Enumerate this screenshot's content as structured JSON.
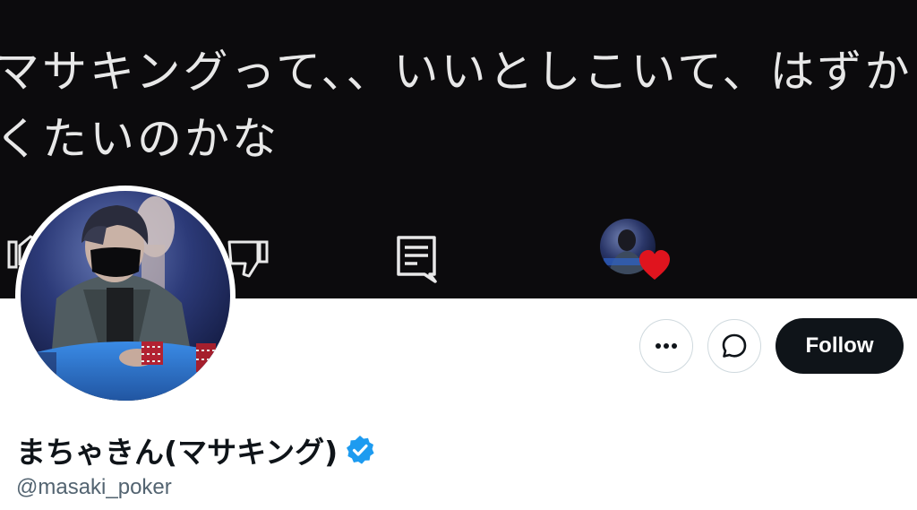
{
  "banner": {
    "line1": "マサキングって、、いいとしこいて、はずか",
    "line2": "くたいのかな",
    "icons": [
      "thumbs-up-icon",
      "thumbs-down-icon",
      "comment-icon",
      "avatar",
      "heart-icon"
    ]
  },
  "actions": {
    "more_icon": "more-horizontal-icon",
    "message_icon": "message-icon",
    "follow_label": "Follow"
  },
  "profile": {
    "display_name": "まちゃきん(マサキング)",
    "verified_icon": "verified-badge-icon",
    "handle": "@masaki_poker"
  },
  "colors": {
    "banner_bg": "#0c0b0d",
    "follow_bg": "#0f1419",
    "verified_blue": "#1d9bf0",
    "handle_gray": "#536471",
    "heart_red": "#e0141e"
  }
}
